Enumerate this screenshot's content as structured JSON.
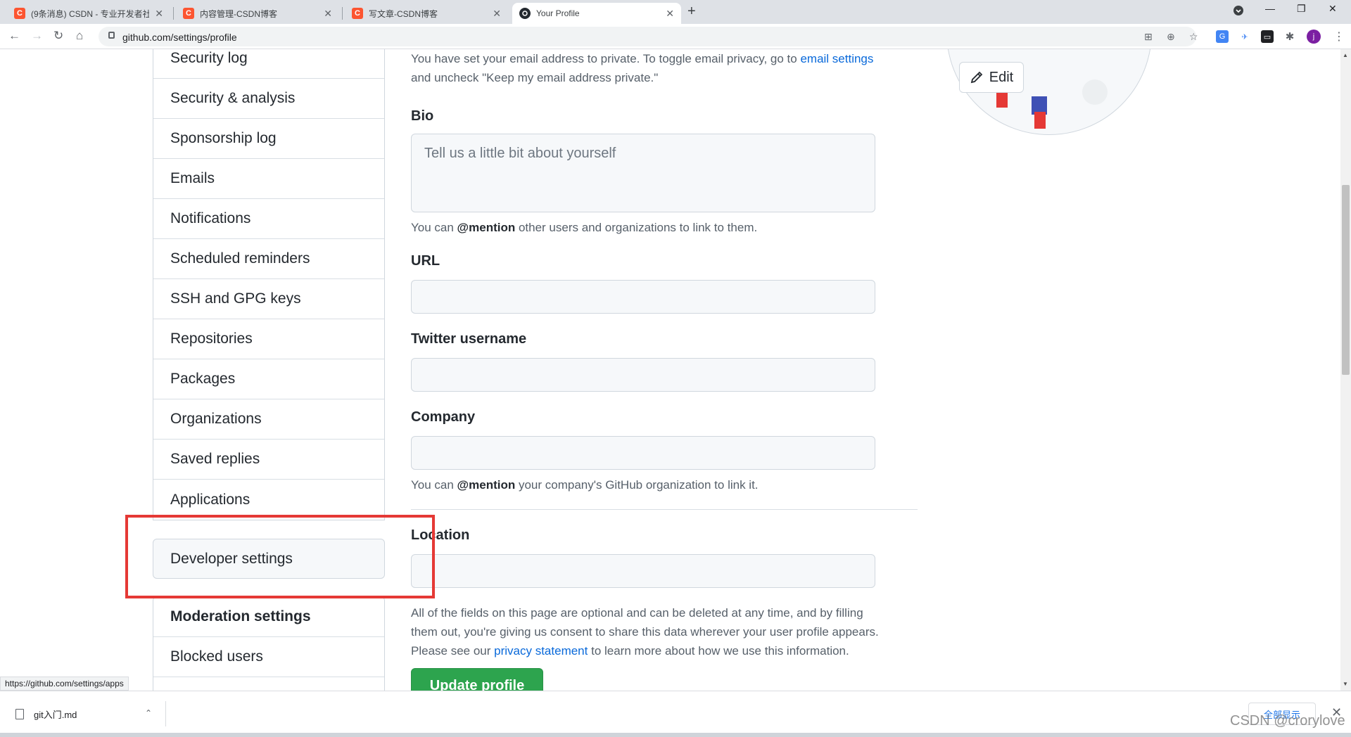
{
  "browser": {
    "tabs": [
      {
        "title": "(9条消息) CSDN - 专业开发者社",
        "icon": "C",
        "active": false
      },
      {
        "title": "内容管理-CSDN博客",
        "icon": "C",
        "active": false
      },
      {
        "title": "写文章-CSDN博客",
        "icon": "C",
        "active": false
      },
      {
        "title": "Your Profile",
        "icon": "github",
        "active": true
      }
    ],
    "url": "github.com/settings/profile",
    "avatar_letter": "j"
  },
  "sidebar": {
    "items": [
      "Security log",
      "Security & analysis",
      "Sponsorship log",
      "Emails",
      "Notifications",
      "Scheduled reminders",
      "SSH and GPG keys",
      "Repositories",
      "Packages",
      "Organizations",
      "Saved replies",
      "Applications"
    ],
    "developer_settings": "Developer settings",
    "moderation_heading": "Moderation settings",
    "moderation_items": [
      "Blocked users"
    ]
  },
  "form": {
    "email_note_prefix": "You have set your email address to private. To toggle email privacy, go to ",
    "email_note_link": "email settings",
    "email_note_suffix": "and uncheck \"Keep my email address private.\"",
    "bio_label": "Bio",
    "bio_placeholder": "Tell us a little bit about yourself",
    "bio_note_prefix": "You can ",
    "bio_note_mention": "@mention",
    "bio_note_suffix": " other users and organizations to link to them.",
    "url_label": "URL",
    "twitter_label": "Twitter username",
    "company_label": "Company",
    "company_note_prefix": "You can ",
    "company_note_mention": "@mention",
    "company_note_suffix": " your company's GitHub organization to link it.",
    "location_label": "Location",
    "optional_note_1": "All of the fields on this page are optional and can be deleted at any time, and by filling",
    "optional_note_2": "them out, you're giving us consent to share this data wherever your user profile appears.",
    "optional_note_3_prefix": "Please see our ",
    "optional_note_3_link": "privacy statement",
    "optional_note_3_suffix": " to learn more about how we use this information.",
    "update_button": "Update profile",
    "edit_button": "Edit"
  },
  "status_bar": {
    "hover_url": "https://github.com/settings/apps"
  },
  "downloads": {
    "file_name": "git入门.md",
    "show_all": "全部显示"
  },
  "watermark": "CSDN @crorylove",
  "colors": {
    "accent_link": "#0969da",
    "primary_button": "#2da44e",
    "highlight_box": "#e53935"
  }
}
